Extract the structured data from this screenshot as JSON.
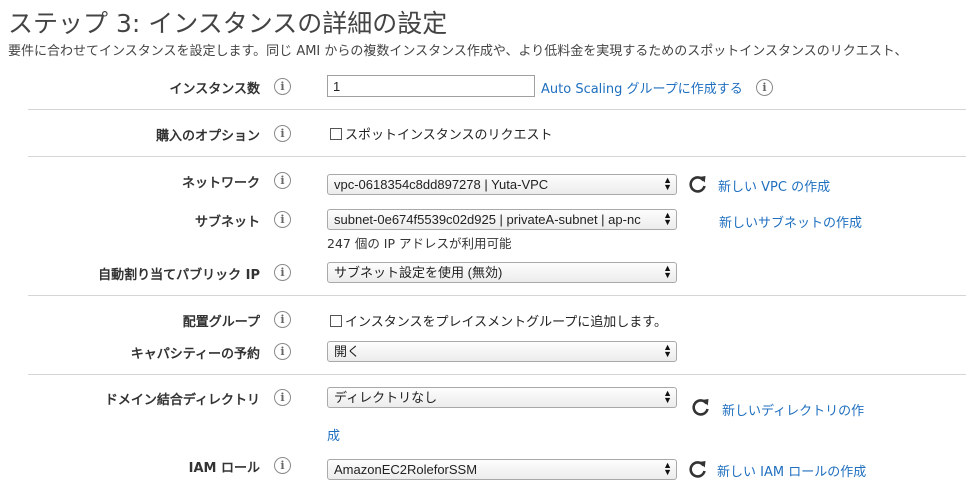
{
  "header": {
    "title": "ステップ 3: インスタンスの詳細の設定",
    "subtitle": "要件に合わせてインスタンスを設定します。同じ AMI からの複数インスタンス作成や、より低料金を実現するためのスポットインスタンスのリクエスト、"
  },
  "rows": {
    "instances": {
      "label": "インスタンス数",
      "value": "1",
      "link": "Auto Scaling グループに作成する"
    },
    "purchase": {
      "label": "購入のオプション",
      "checkbox_label": "スポットインスタンスのリクエスト"
    },
    "network": {
      "label": "ネットワーク",
      "value": "vpc-0618354c8dd897278 | Yuta-VPC",
      "link": "新しい VPC の作成"
    },
    "subnet": {
      "label": "サブネット",
      "value": "subnet-0e674f5539c02d925 | privateA-subnet | ap-nc",
      "hint": "247 個の IP アドレスが利用可能",
      "link": "新しいサブネットの作成"
    },
    "public_ip": {
      "label": "自動割り当てパブリック IP",
      "value": "サブネット設定を使用 (無効)"
    },
    "placement": {
      "label": "配置グループ",
      "checkbox_label": "インスタンスをプレイスメントグループに追加します。"
    },
    "capacity": {
      "label": "キャパシティーの予約",
      "value": "開く"
    },
    "domain": {
      "label": "ドメイン結合ディレクトリ",
      "value": "ディレクトリなし",
      "link_line1": "新しいディレクトリの作",
      "link_line2": "成"
    },
    "iam": {
      "label": "IAM ロール",
      "value": "AmazonEC2RoleforSSM",
      "link": "新しい IAM ロールの作成"
    }
  },
  "icons": {
    "info": "info-icon",
    "refresh": "refresh-icon",
    "select_arrows": "select-arrows-icon"
  },
  "colors": {
    "link": "#1f6fbf",
    "text": "#333333"
  }
}
